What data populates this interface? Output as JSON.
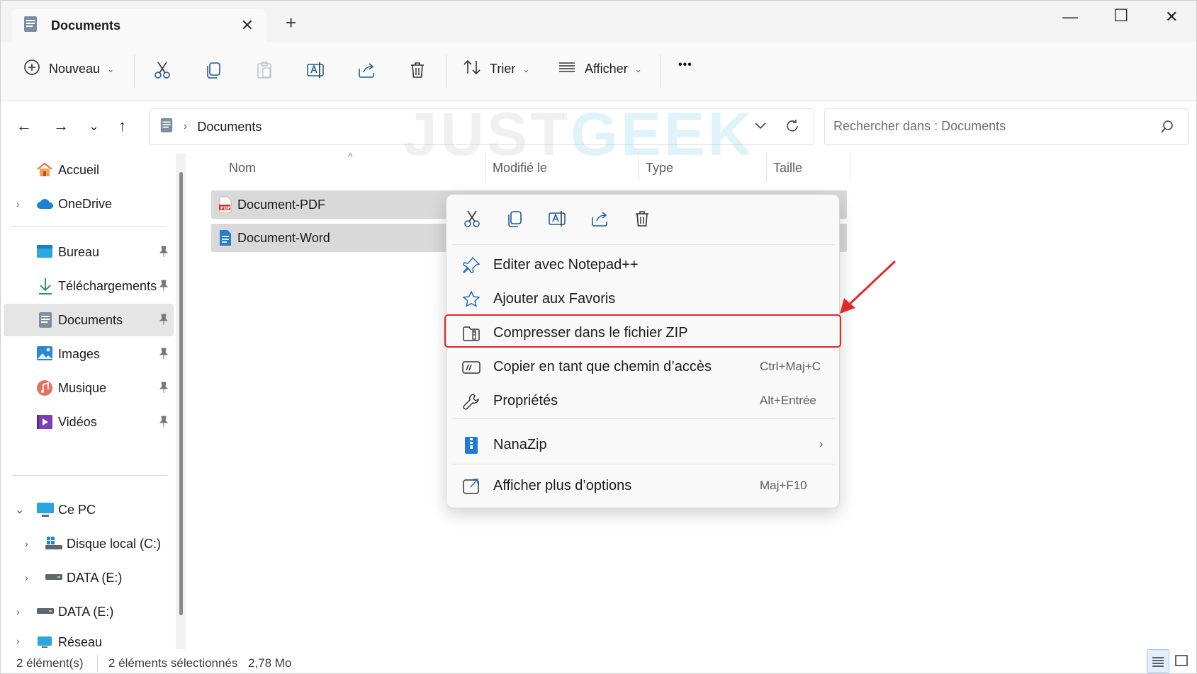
{
  "window": {
    "tab_title": "Documents",
    "tab_close": "✕",
    "new_tab": "+",
    "minimize": "—",
    "maximize": "☐",
    "close": "✕"
  },
  "toolbar": {
    "new_label": "Nouveau",
    "sort_label": "Trier",
    "view_label": "Afficher",
    "more_label": "•••"
  },
  "address": {
    "separator": "›",
    "path": "Documents",
    "search_placeholder": "Rechercher dans : Documents"
  },
  "watermark": {
    "part1": "JUST",
    "part2": "GEEK"
  },
  "sidebar": {
    "home": "Accueil",
    "onedrive": "OneDrive",
    "desktop": "Bureau",
    "downloads": "Téléchargements",
    "documents": "Documents",
    "pictures": "Images",
    "music": "Musique",
    "videos": "Vidéos",
    "this_pc": "Ce PC",
    "local_disk": "Disque local (C:)",
    "data_e_1": "DATA (E:)",
    "data_e_2": "DATA (E:)",
    "network": "Réseau"
  },
  "file_list": {
    "columns": [
      "Nom",
      "Modifié le",
      "Type",
      "Taille"
    ],
    "files": [
      {
        "name": "Document-PDF",
        "icon": "pdf-icon"
      },
      {
        "name": "Document-Word",
        "icon": "word-icon"
      }
    ]
  },
  "context_menu": {
    "items": [
      {
        "label": "Editer avec Notepad++",
        "shortcut": "",
        "icon": "pin-icon"
      },
      {
        "label": "Ajouter aux Favoris",
        "shortcut": "",
        "icon": "star-icon"
      },
      {
        "label": "Compresser dans le fichier ZIP",
        "shortcut": "",
        "icon": "zip-folder-icon",
        "highlighted": true
      },
      {
        "label": "Copier en tant que chemin d’accès",
        "shortcut": "Ctrl+Maj+C",
        "icon": "copy-path-icon"
      },
      {
        "label": "Propriétés",
        "shortcut": "Alt+Entrée",
        "icon": "wrench-icon"
      },
      {
        "label": "NanaZip",
        "shortcut": "",
        "icon": "nanazip-icon",
        "submenu": true
      },
      {
        "label": "Afficher plus d’options",
        "shortcut": "Maj+F10",
        "icon": "more-options-icon"
      }
    ],
    "submenu_arrow": "›",
    "highlight_color": "#e02a2a"
  },
  "status": {
    "count": "2 élément(s)",
    "selected": "2 éléments sélectionnés",
    "size": "2,78 Mo"
  },
  "colors": {
    "accent": "#0067c0",
    "selection": "#d9d9d9",
    "annotation_arrow": "#e02a2a"
  }
}
